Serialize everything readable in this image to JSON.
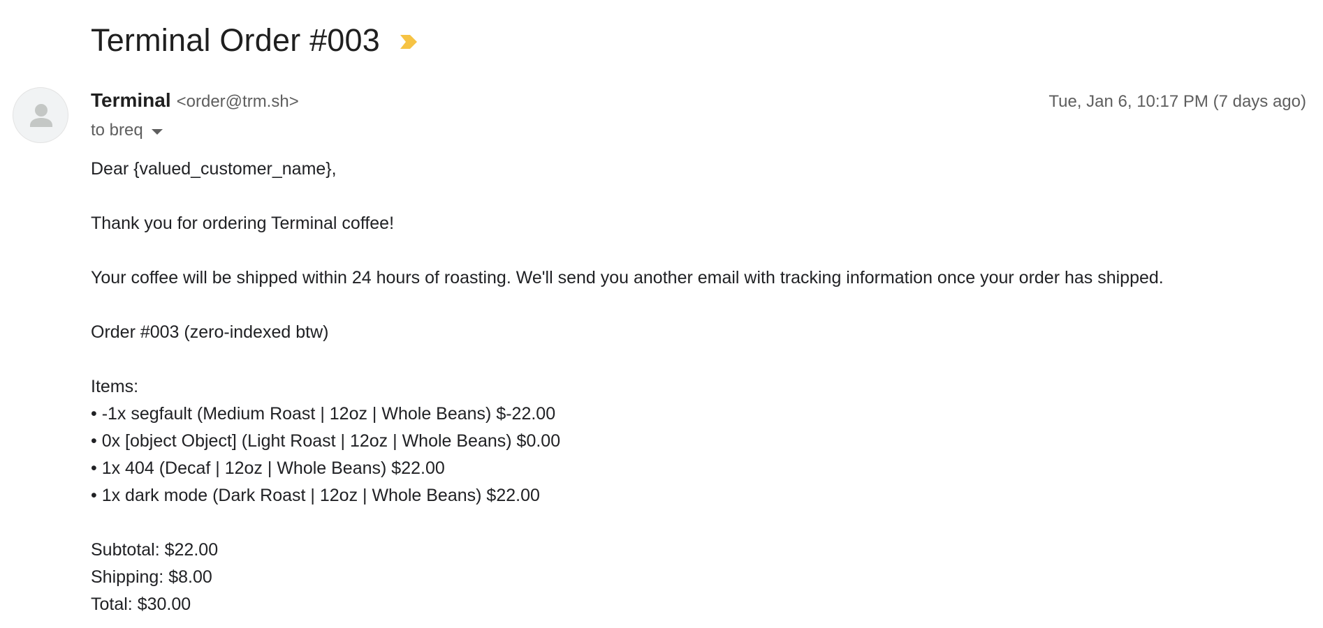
{
  "email": {
    "subject": "Terminal Order #003",
    "sender": {
      "name": "Terminal",
      "email": "<order@trm.sh>"
    },
    "date": "Tue, Jan 6, 10:17 PM (7 days ago)",
    "recipient": "to breq",
    "colors": {
      "importance_marker": "#F6C344",
      "avatar_bg": "#F1F3F4",
      "avatar_icon": "#C4C7C5"
    },
    "body": {
      "greeting": "Dear {valued_customer_name},",
      "thanks": "Thank you for ordering Terminal coffee!",
      "shipping_note": "Your coffee will be shipped within 24 hours of roasting. We'll send you another email with tracking information once your order has shipped.",
      "order_line": "Order #003 (zero-indexed btw)",
      "items_label": "Items:",
      "items": [
        "• -1x segfault (Medium Roast | 12oz | Whole Beans) $-22.00",
        "• 0x [object Object] (Light Roast | 12oz | Whole Beans) $0.00",
        "• 1x 404 (Decaf | 12oz | Whole Beans) $22.00",
        "• 1x dark mode (Dark Roast | 12oz | Whole Beans) $22.00"
      ],
      "subtotal": "Subtotal: $22.00",
      "shipping": "Shipping: $8.00",
      "total": "Total: $30.00"
    }
  },
  "icons": {
    "importance": "importance-marker-icon",
    "avatar": "person-icon",
    "recipient_dropdown": "caret-down-icon"
  }
}
